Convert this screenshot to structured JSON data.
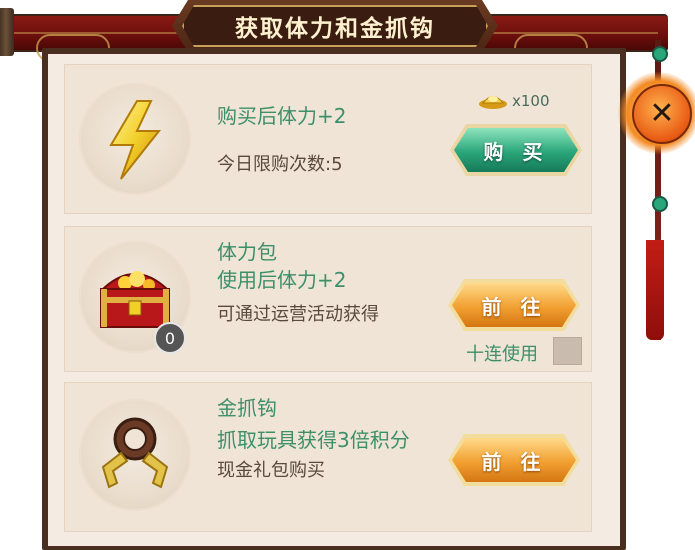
{
  "dialog": {
    "title": "获取体力和金抓钩"
  },
  "items": [
    {
      "icon": "lightning-icon",
      "title": "购买后体力+2",
      "subtitle": "今日限购次数:5",
      "button_label": "购 买",
      "cost_icon": "gold-ingot-icon",
      "cost_text": "x100"
    },
    {
      "icon": "treasure-chest-icon",
      "title_line1": "体力包",
      "title_line2": "使用后体力+2",
      "subtitle": "可通过运营活动获得",
      "button_label": "前 往",
      "count_badge": "0",
      "ten_use_label": "十连使用"
    },
    {
      "icon": "golden-claw-icon",
      "title_line1": "金抓钩",
      "title_line2": "抓取玩具获得3倍积分",
      "subtitle": "现金礼包购买",
      "button_label": "前 往"
    }
  ],
  "close": {
    "icon": "close-icon"
  },
  "colors": {
    "title_text": "#fff1cf",
    "accent_green": "#3d8f6a",
    "buy_button": "#2aa67b",
    "go_button": "#f2a031",
    "panel_bg": "#f4ece2",
    "frame": "#4a2f20"
  }
}
